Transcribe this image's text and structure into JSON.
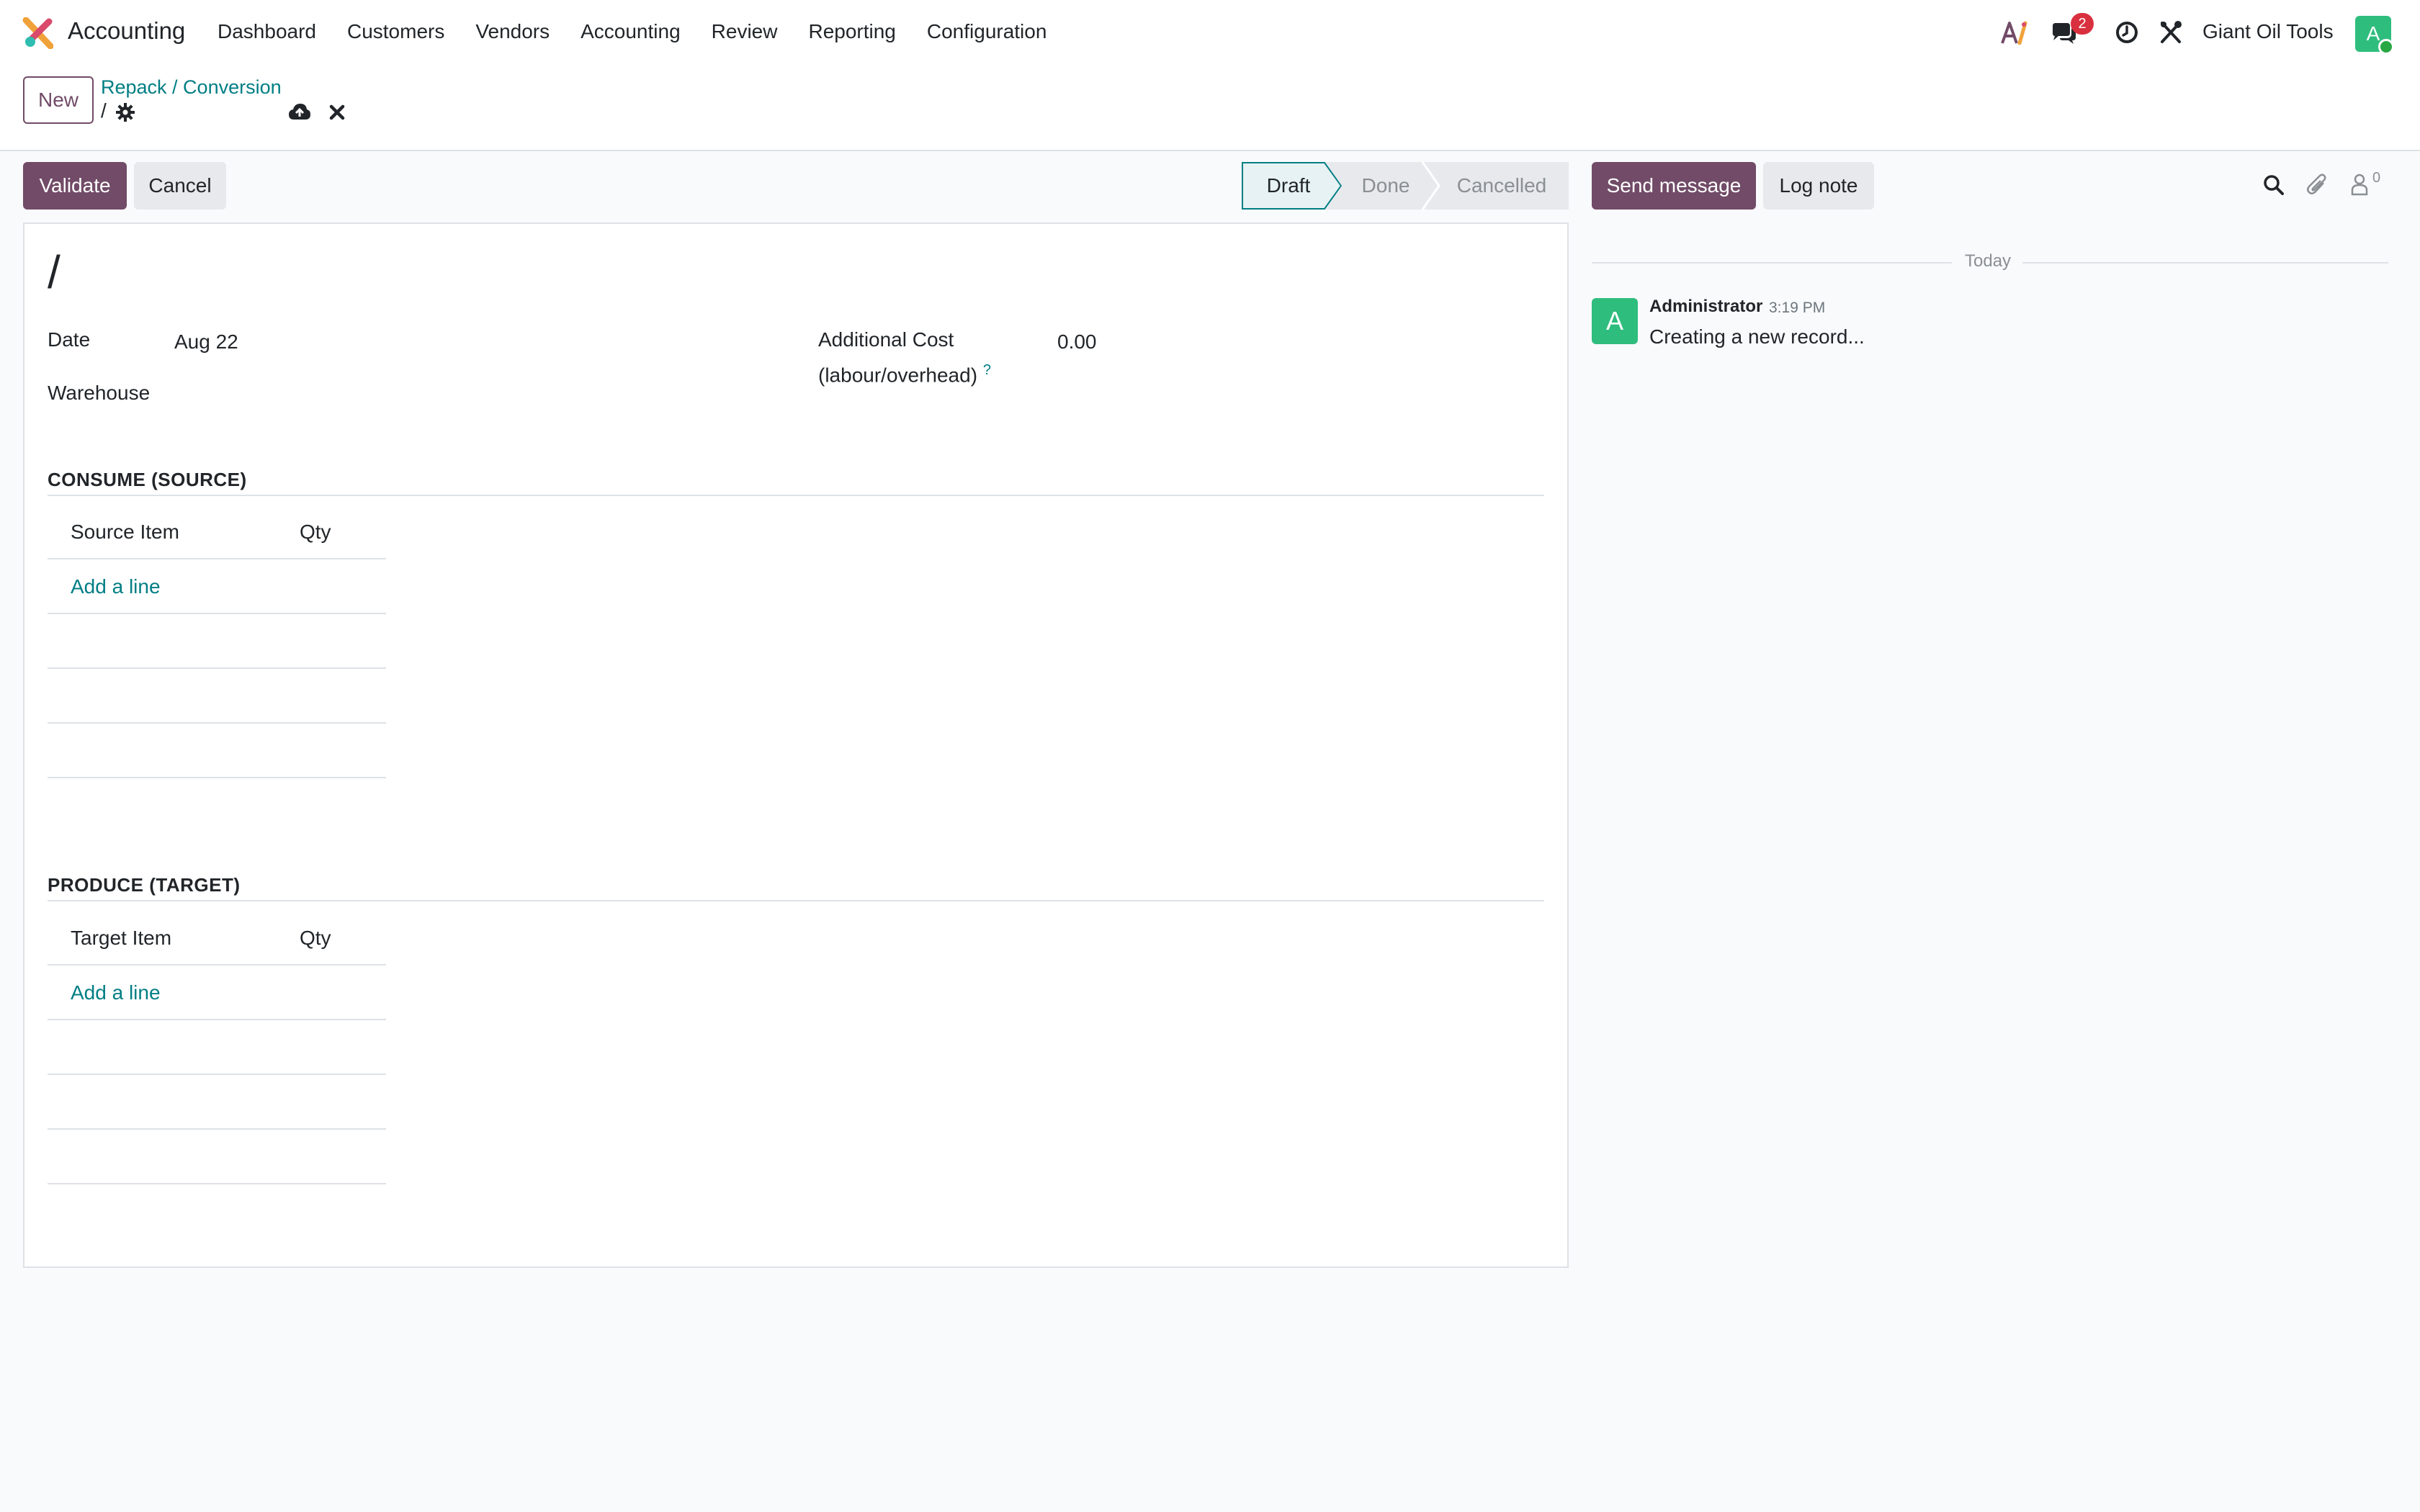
{
  "navbar": {
    "app_name": "Accounting",
    "menu": [
      "Dashboard",
      "Customers",
      "Vendors",
      "Accounting",
      "Review",
      "Reporting",
      "Configuration"
    ],
    "chat_badge": "2",
    "company": "Giant Oil Tools",
    "user_initial": "A"
  },
  "control": {
    "new_label": "New",
    "breadcrumb": "Repack / Conversion",
    "record_name": "/"
  },
  "form": {
    "validate_label": "Validate",
    "cancel_label": "Cancel",
    "status_steps": [
      "Draft",
      "Done",
      "Cancelled"
    ],
    "active_status": "Draft",
    "title": "/",
    "date_label": "Date",
    "date_value": "Aug 22",
    "warehouse_label": "Warehouse",
    "additional_cost_label_1": "Additional Cost",
    "additional_cost_label_2": "(labour/overhead)",
    "help_mark": "?",
    "additional_cost_value": "0.00",
    "consume": {
      "title": "CONSUME (SOURCE)",
      "col_item": "Source Item",
      "col_qty": "Qty",
      "add_line": "Add a line"
    },
    "produce": {
      "title": "PRODUCE (TARGET)",
      "col_item": "Target Item",
      "col_qty": "Qty",
      "add_line": "Add a line"
    }
  },
  "chatter": {
    "send_message_label": "Send message",
    "log_note_label": "Log note",
    "followers_count": "0",
    "day_separator": "Today",
    "messages": [
      {
        "initial": "A",
        "author": "Administrator",
        "time": "3:19 PM",
        "body": "Creating a new record..."
      }
    ]
  },
  "colors": {
    "brand": "#714b67",
    "link": "#017e84",
    "avatar": "#2ebd7d",
    "badge": "#d9303f"
  }
}
